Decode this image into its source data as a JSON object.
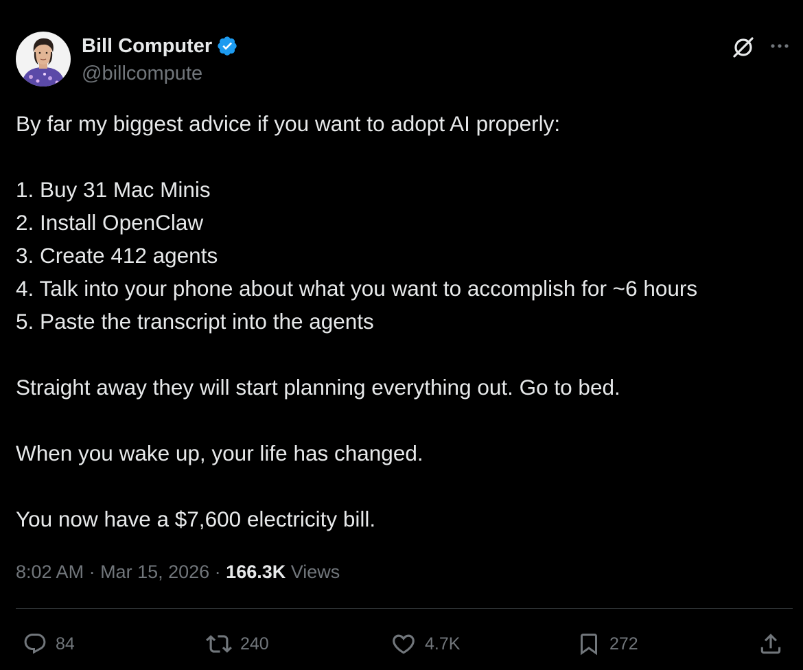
{
  "author": {
    "display_name": "Bill Computer",
    "handle": "@billcompute",
    "verified_icon": "verified-badge-icon",
    "verified_color": "#1d9bf0"
  },
  "tweet": {
    "lines": [
      "By far my biggest advice if you want to adopt AI properly:",
      "",
      "1. Buy 31 Mac Minis",
      "2. Install OpenClaw",
      "3. Create 412 agents",
      "4. Talk into your phone about what you want to accomplish for ~6 hours",
      "5. Paste the transcript into the agents",
      "",
      "Straight away they will start planning everything out. Go to bed.",
      "",
      "When you wake up, your life has changed.",
      "",
      "You now have a $7,600 electricity bill."
    ],
    "time": "8:02 AM",
    "date": "Mar 15, 2026",
    "separator": " · ",
    "views_count": "166.3K",
    "views_label": " Views"
  },
  "actions": {
    "replies": "84",
    "reposts": "240",
    "likes": "4.7K",
    "bookmarks": "272"
  },
  "colors": {
    "background": "#000000",
    "text_primary": "#e7e9ea",
    "text_secondary": "#71767b",
    "divider": "#2f3336"
  }
}
